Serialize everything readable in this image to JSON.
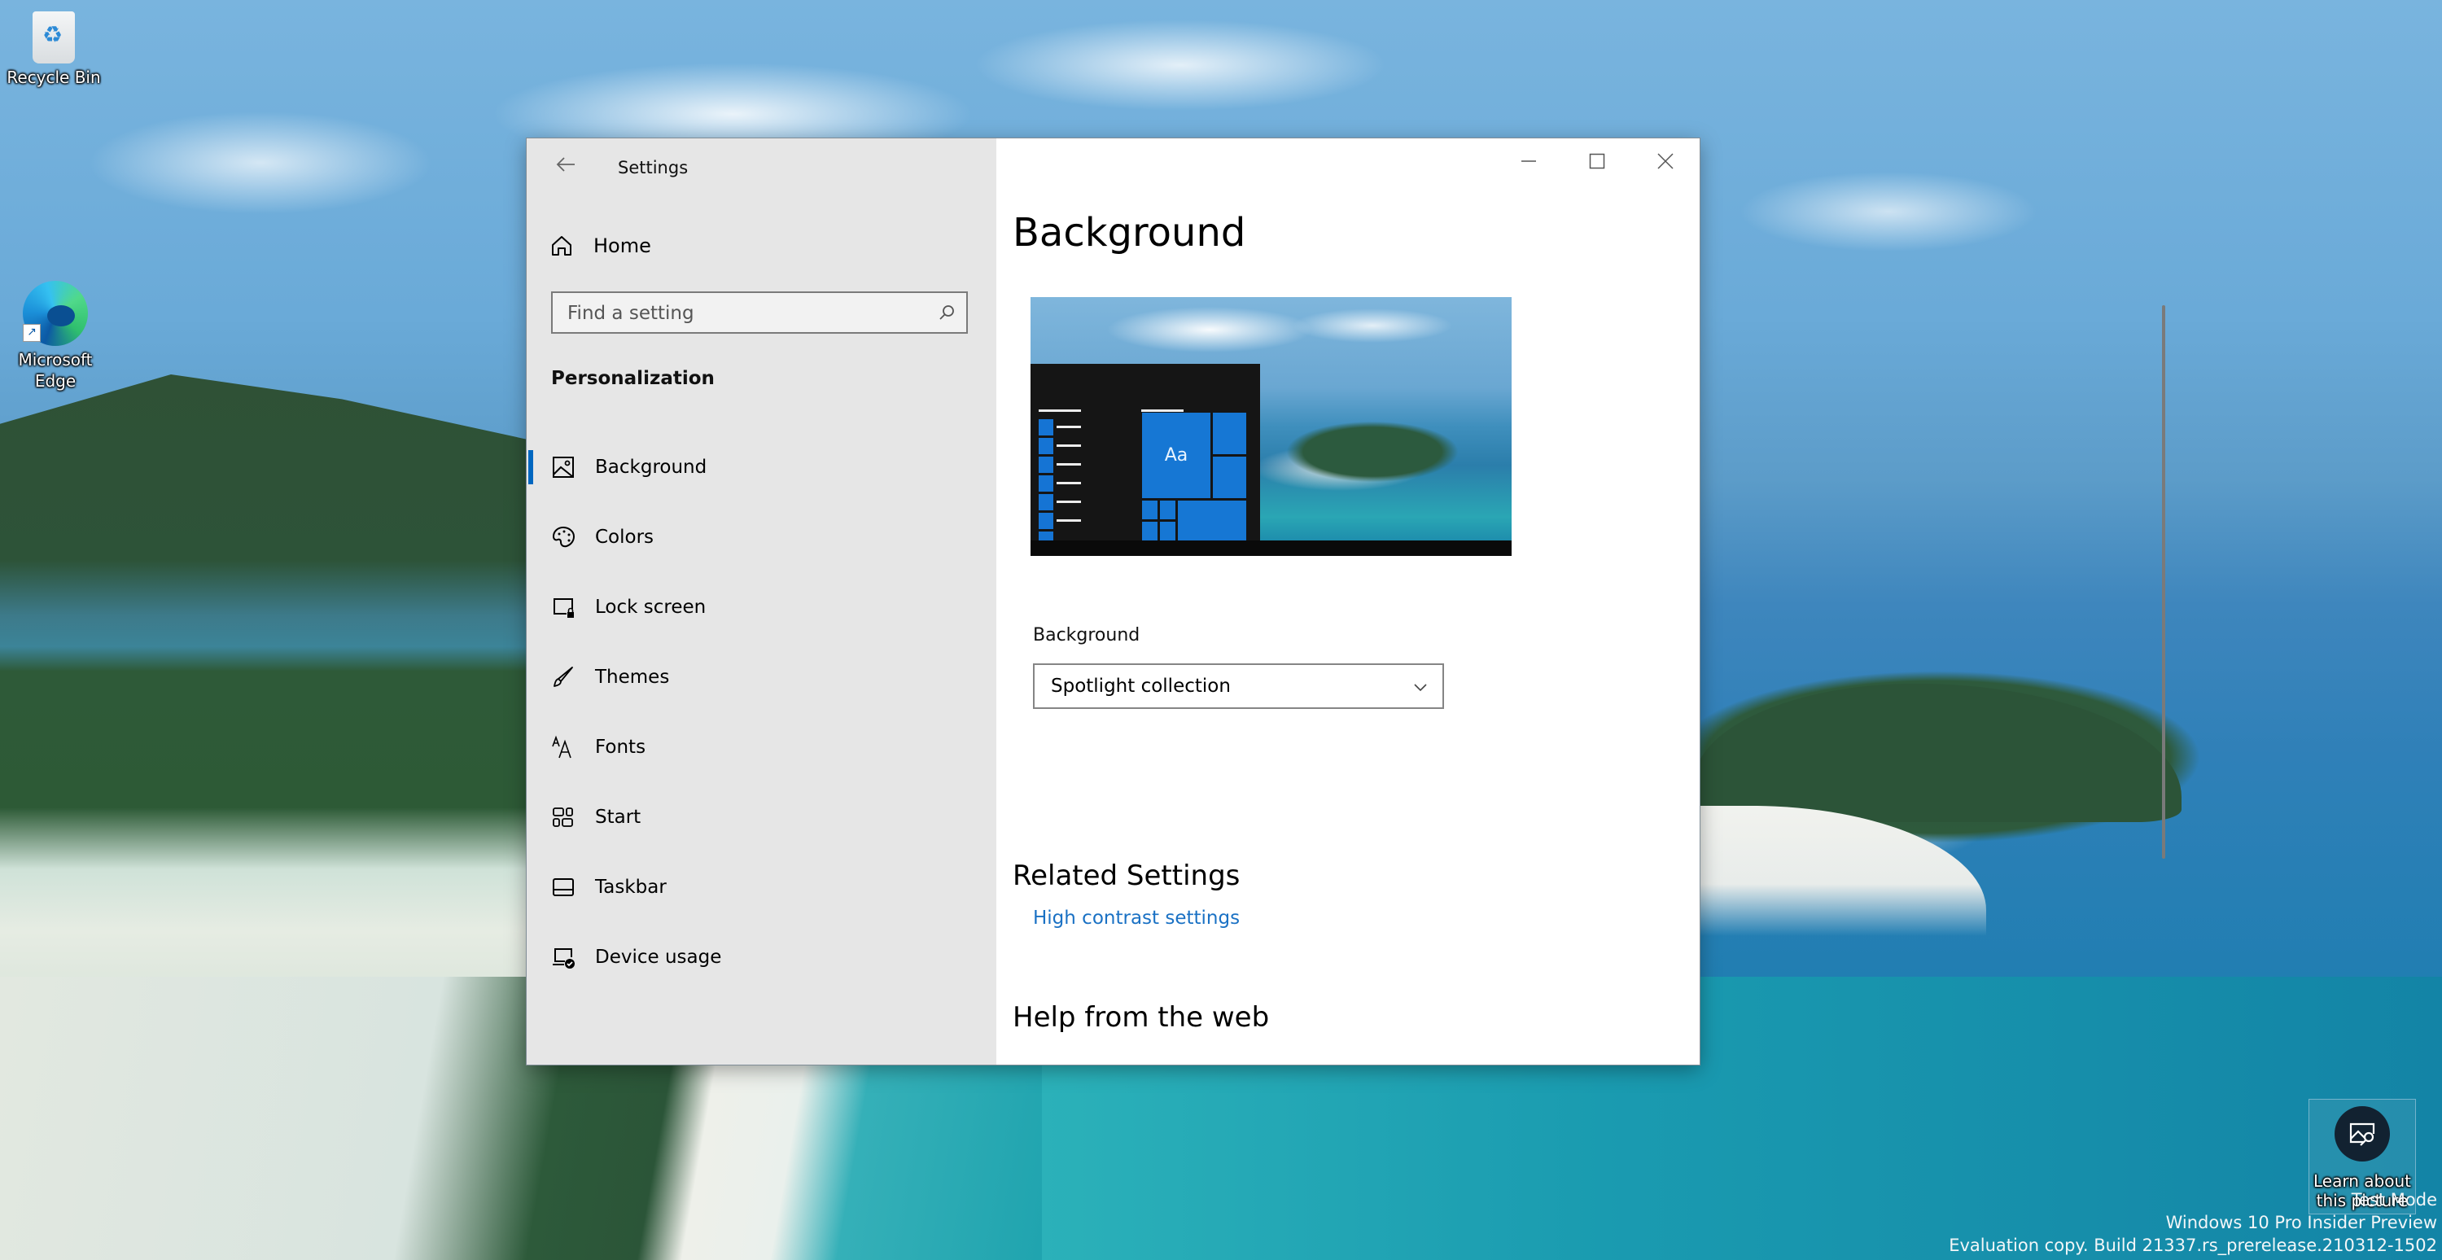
{
  "desktop": {
    "icons": [
      {
        "label": "Recycle Bin",
        "icon": "recycle-bin-icon"
      },
      {
        "label": "Microsoft Edge",
        "icon": "edge-icon"
      }
    ],
    "learn_picture": {
      "label": "Learn about this picture",
      "icon": "picture-search-icon"
    },
    "watermark": {
      "line1": "Test Mode",
      "line2": "Windows 10 Pro Insider Preview",
      "line3": "Evaluation copy. Build 21337.rs_prerelease.210312-1502"
    }
  },
  "window": {
    "title": "Settings",
    "back_icon": "arrow-left-icon",
    "controls": {
      "minimize": "minimize-icon",
      "maximize": "maximize-icon",
      "close": "close-icon"
    }
  },
  "sidebar": {
    "home": {
      "label": "Home",
      "icon": "home-icon"
    },
    "search": {
      "placeholder": "Find a setting",
      "value": "",
      "icon": "search-icon"
    },
    "section": "Personalization",
    "items": [
      {
        "label": "Background",
        "icon": "picture-icon",
        "selected": true
      },
      {
        "label": "Colors",
        "icon": "palette-icon",
        "selected": false
      },
      {
        "label": "Lock screen",
        "icon": "lock-screen-icon",
        "selected": false
      },
      {
        "label": "Themes",
        "icon": "brush-icon",
        "selected": false
      },
      {
        "label": "Fonts",
        "icon": "fonts-icon",
        "selected": false
      },
      {
        "label": "Start",
        "icon": "start-icon",
        "selected": false
      },
      {
        "label": "Taskbar",
        "icon": "taskbar-icon",
        "selected": false
      },
      {
        "label": "Device usage",
        "icon": "device-usage-icon",
        "selected": false
      }
    ]
  },
  "main": {
    "title": "Background",
    "preview": {
      "tile_text": "Aa"
    },
    "background_field": {
      "label": "Background",
      "selected": "Spotlight collection"
    },
    "related_settings": {
      "title": "Related Settings",
      "links": [
        "High contrast settings"
      ]
    },
    "help": {
      "title": "Help from the web"
    }
  },
  "colors": {
    "accent": "#0067c0",
    "link": "#1a71c4",
    "sidebar_bg": "#e6e6e6",
    "content_bg": "#ffffff"
  }
}
